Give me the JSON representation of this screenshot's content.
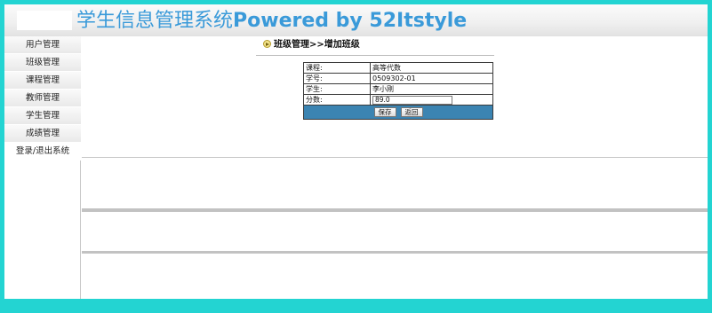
{
  "header": {
    "title_cn": "学生信息管理系统",
    "title_en": "Powered by 52Itstyle"
  },
  "sidebar": {
    "items": [
      {
        "label": "用户管理"
      },
      {
        "label": "班级管理"
      },
      {
        "label": "课程管理"
      },
      {
        "label": "教师管理"
      },
      {
        "label": "学生管理"
      },
      {
        "label": "成绩管理"
      },
      {
        "label": "登录/退出系统"
      }
    ]
  },
  "main": {
    "breadcrumb": "班级管理>>增加班级",
    "form": {
      "rows": [
        {
          "label": "课程:",
          "value": "高等代数"
        },
        {
          "label": "学号:",
          "value": "0509302-01"
        },
        {
          "label": "学生:",
          "value": "李小刚"
        }
      ],
      "score_label": "分数:",
      "score_value": "89.0",
      "save_label": "保存",
      "back_label": "返回"
    }
  },
  "colors": {
    "background": "#23d4d2",
    "title": "#3a9ad9",
    "button_bar": "#3b84b2"
  },
  "icons": {
    "breadcrumb": "arrow-circle-icon"
  }
}
